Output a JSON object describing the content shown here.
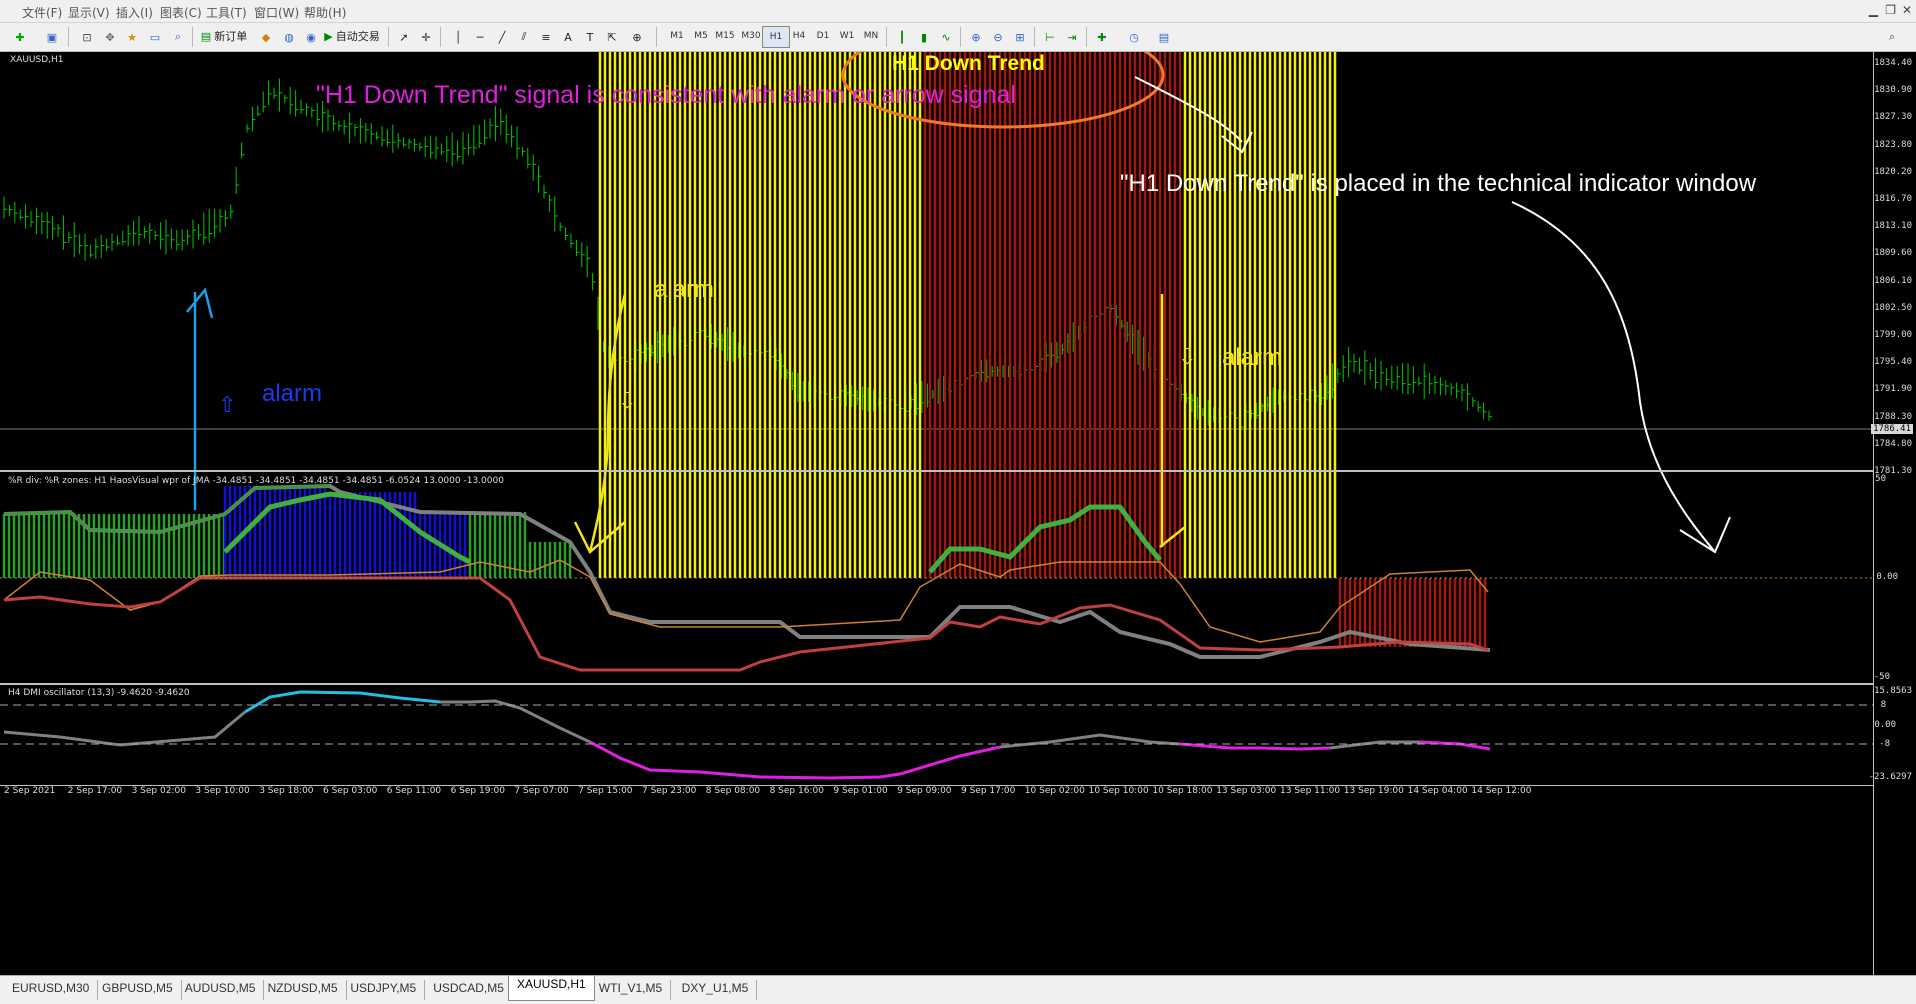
{
  "menu": [
    "文件(F)",
    "显示(V)",
    "插入(I)",
    "图表(C)",
    "工具(T)",
    "窗口(W)",
    "帮助(H)"
  ],
  "toolbar": {
    "new_order": "新订单",
    "auto_trading": "自动交易",
    "timeframes": [
      "M1",
      "M5",
      "M15",
      "M30",
      "H1",
      "H4",
      "D1",
      "W1",
      "MN"
    ],
    "active_timeframe": "H1"
  },
  "chart": {
    "symbol": "XAUUSD,H1",
    "current_price": "1786.41",
    "price_axis": [
      "1834.40",
      "1830.90",
      "1827.30",
      "1823.80",
      "1820.20",
      "1816.70",
      "1813.10",
      "1809.60",
      "1806.10",
      "1802.50",
      "1799.00",
      "1795.40",
      "1791.90",
      "1788.30",
      "1784.80",
      "1781.30"
    ],
    "colors": {
      "bullish": "#00c800",
      "background": "#000000"
    }
  },
  "indicator1": {
    "title": "%R div: %R zones: H1 HaosVisual wpr of JMA -34.4851 -34.4851 -34.4851 -34.4851 -6.0524 13.0000 -13.0000",
    "axis": [
      "50",
      "0.00",
      "-50"
    ]
  },
  "indicator2": {
    "title": "H4 DMI oscillator (13,3) -9.4620 -9.4620",
    "axis": [
      "15.8563",
      "8",
      "0.00",
      "-8",
      "-23.6297"
    ]
  },
  "time_axis": [
    "2 Sep 2021",
    "2 Sep 17:00",
    "3 Sep 02:00",
    "3 Sep 10:00",
    "3 Sep 18:00",
    "6 Sep 03:00",
    "6 Sep 11:00",
    "6 Sep 19:00",
    "7 Sep 07:00",
    "7 Sep 15:00",
    "7 Sep 23:00",
    "8 Sep 08:00",
    "8 Sep 16:00",
    "9 Sep 01:00",
    "9 Sep 09:00",
    "9 Sep 17:00",
    "10 Sep 02:00",
    "10 Sep 10:00",
    "10 Sep 18:00",
    "13 Sep 03:00",
    "13 Sep 11:00",
    "13 Sep 19:00",
    "14 Sep 04:00",
    "14 Sep 12:00"
  ],
  "annotations": {
    "h1_down_trend": "H1 Down Trend",
    "signal_note": "\"H1 Down Trend\" signal is consistent with alarm or arrow signal",
    "placement_note": "\"H1 Down Trend\" is placed in the technical indicator window",
    "alarm": "alarm"
  },
  "tabs": [
    "EURUSD,M30",
    "GBPUSD,M5",
    "AUDUSD,M5",
    "NZDUSD,M5",
    "USDJPY,M5",
    "USDCAD,M5",
    "XAUUSD,H1",
    "WTI_V1,M5",
    "DXY_U1,M5"
  ],
  "active_tab": "XAUUSD,H1"
}
